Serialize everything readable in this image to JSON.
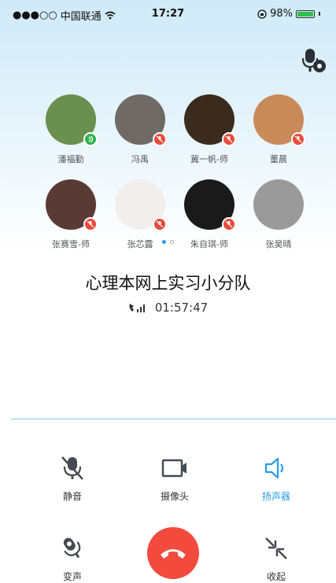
{
  "status_bar": {
    "signal": "●●●○○",
    "carrier": "中国联通",
    "time": "17:27",
    "battery": "98%",
    "battery_level": 0.98
  },
  "participants": [
    {
      "name": "潘福勤",
      "state": "talking",
      "avatar_color": "#6a8f4e"
    },
    {
      "name": "冯禹",
      "state": "muted",
      "avatar_color": "#6f6a66"
    },
    {
      "name": "冀一帆-师",
      "state": "muted",
      "avatar_color": "#3b2a1e"
    },
    {
      "name": "董晨",
      "state": "muted",
      "avatar_color": "#c98a5a"
    },
    {
      "name": "张赛雪-师",
      "state": "muted",
      "avatar_color": "#5a3a34"
    },
    {
      "name": "张芯露",
      "state": "muted",
      "avatar_color": "#f0efec"
    },
    {
      "name": "朱自琪-师",
      "state": "muted",
      "avatar_color": "#1a1a1a"
    },
    {
      "name": "张昊晴",
      "state": "none",
      "avatar_color": "#9a9a9a"
    }
  ],
  "call": {
    "group_name": "心理本网上实习小分队",
    "duration": "01:57:47"
  },
  "controls": {
    "mute": "静音",
    "camera": "摄像头",
    "speaker": "扬声器",
    "voice_change": "变声",
    "collapse": "收起"
  },
  "colors": {
    "accent": "#2b9ee8",
    "hangup": "#f24b3e",
    "muted_badge": "#e94b3c",
    "talking_badge": "#2fb14a"
  }
}
